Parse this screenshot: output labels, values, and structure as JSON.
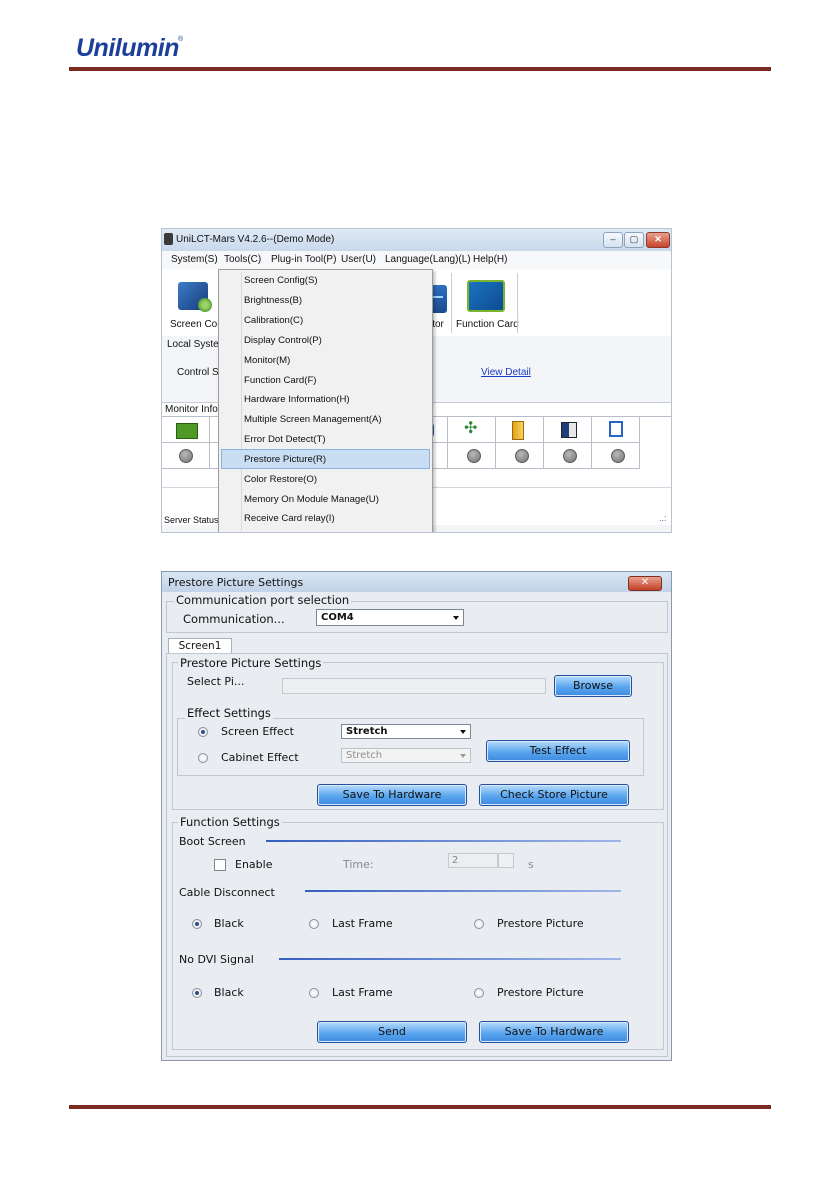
{
  "header": {
    "logo_text": "Unilumin",
    "logo_mark": "®"
  },
  "app": {
    "title": "UniLCT-Mars V4.2.6--(Demo Mode)",
    "window_buttons": [
      "–",
      "▢",
      "✕"
    ],
    "menu": [
      "System(S)",
      "Tools(C)",
      "Plug-in Tool(P)",
      "User(U)",
      "Language(Lang)(L)",
      "Help(H)"
    ],
    "toolbar": {
      "screen_config": "Screen Cont",
      "monitor": "itor",
      "function_card": "Function Card"
    },
    "local_system": "Local System",
    "control_system": "Control Sy",
    "view_detail": "View Detail",
    "monitor_info": "Monitor Info",
    "server_status": "Server Status:",
    "resize_grip": "..:",
    "tools_menu": [
      "Screen Config(S)",
      "Brightness(B)",
      "Calibration(C)",
      "Display Control(P)",
      "Monitor(M)",
      "Function Card(F)",
      "Hardware Information(H)",
      "Multiple Screen Management(A)",
      "Error Dot Detect(T)",
      "Prestore Picture(R)",
      "Color Restore(O)",
      "Memory On Module Manage(U)",
      "Receive Card relay(I)"
    ],
    "highlighted_menu_item": "Prestore Picture(R)"
  },
  "dialog": {
    "title": "Prestore Picture Settings",
    "close": "✕",
    "comm_group": "Communication port selection",
    "comm_label": "Communication...",
    "comm_value": "COM4",
    "tab": "Screen1",
    "prestore_group": "Prestore Picture Settings",
    "select_label": "Select Pi...",
    "select_value": "",
    "browse": "Browse",
    "effect_group": "Effect Settings",
    "screen_effect": "Screen Effect",
    "screen_effect_value": "Stretch",
    "cabinet_effect": "Cabinet Effect",
    "cabinet_effect_value": "Stretch",
    "test_effect": "Test Effect",
    "save_to_hardware": "Save To Hardware",
    "check_store_picture": "Check Store Picture",
    "function_group": "Function Settings",
    "boot_screen": "Boot Screen",
    "enable": "Enable",
    "time_label": "Time:",
    "time_value": "2",
    "time_unit": "s",
    "cable_disconnect": "Cable Disconnect",
    "no_dvi_signal": "No DVI Signal",
    "opt_black": "Black",
    "opt_last_frame": "Last Frame",
    "opt_prestore": "Prestore Picture",
    "send": "Send",
    "save_to_hardware_2": "Save To Hardware",
    "colors": {
      "button_blue": "#5aa6ee",
      "title_bar": "#c2d3e8"
    }
  }
}
